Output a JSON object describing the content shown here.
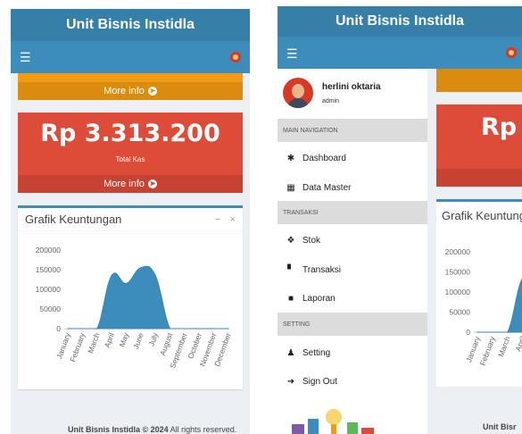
{
  "left": {
    "app_title": "Unit Bisnis Instidla",
    "yellow_box": {
      "more_info": "More info"
    },
    "red_box": {
      "amount": "Rp 3.313.200",
      "label": "Total Kas",
      "more_info": "More info"
    },
    "chart_box": {
      "title": "Grafik Keuntungan",
      "minimize": "−",
      "close": "×"
    },
    "footer": {
      "brand": "Unit Bisnis Instidla © 2024",
      "rest": " All rights reserved."
    }
  },
  "right": {
    "app_title": "Unit Bisnis Instidla",
    "user": {
      "name": "herlini oktaria",
      "role": "admin"
    },
    "sections": {
      "main_nav": "MAIN NAVIGATION",
      "transaksi": "TRANSAKSI",
      "setting": "SETTING"
    },
    "menu": {
      "dashboard": "Dashboard",
      "data_master": "Data Master",
      "stok": "Stok",
      "transaksi": "Transaksi",
      "laporan": "Laporan",
      "setting": "Setting",
      "sign_out": "Sign Out"
    },
    "partial": {
      "amount": "Rp 3",
      "chart_title": "Grafik Keuntung",
      "footer": "Unit Bisr"
    }
  },
  "icons": {
    "menu": "hamburger-icon",
    "more_info": "arrow-circle-right-icon",
    "dashboard": "dashboard-icon",
    "data_master": "table-icon",
    "stok": "cubes-icon",
    "transaksi": "cart-icon",
    "laporan": "folder-icon",
    "setting": "user-icon",
    "sign_out": "sign-out-icon"
  },
  "colors": {
    "header_dark": "#367fa9",
    "header": "#3c8dbc",
    "yellow": "#f39c12",
    "red": "#dd4b39",
    "area": "#3c8dbc"
  },
  "chart_data": {
    "type": "area",
    "categories": [
      "January",
      "February",
      "March",
      "April",
      "May",
      "June",
      "July",
      "August",
      "September",
      "October",
      "November",
      "December"
    ],
    "values": [
      0,
      0,
      0,
      135000,
      115000,
      155000,
      135000,
      0,
      0,
      0,
      0,
      0
    ],
    "ylim": [
      0,
      200000
    ],
    "yticks": [
      0,
      50000,
      100000,
      150000,
      200000
    ],
    "title": "Grafik Keuntungan"
  }
}
